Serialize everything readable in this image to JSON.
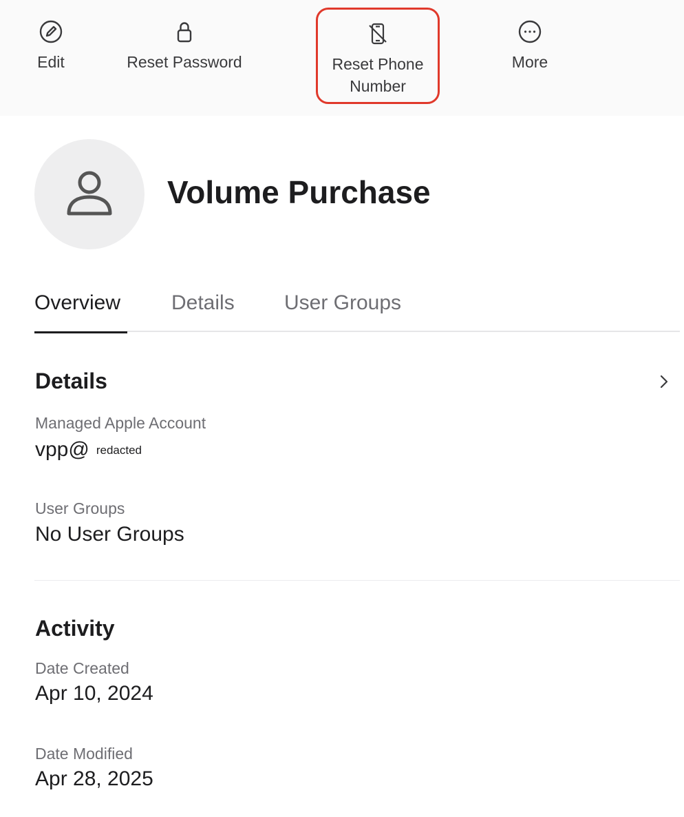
{
  "toolbar": {
    "edit": {
      "label": "Edit",
      "icon": "pencil-circle-icon"
    },
    "reset_password": {
      "label": "Reset Password",
      "icon": "lock-icon"
    },
    "reset_phone": {
      "label": "Reset Phone Number",
      "icon": "phone-slash-icon",
      "highlight_color": "#e0392b"
    },
    "more": {
      "label": "More",
      "icon": "ellipsis-circle-icon"
    }
  },
  "user": {
    "name": "Volume Purchase",
    "avatar_icon": "person-icon"
  },
  "tabs": [
    {
      "label": "Overview",
      "active": true
    },
    {
      "label": "Details",
      "active": false
    },
    {
      "label": "User Groups",
      "active": false
    }
  ],
  "details": {
    "title": "Details",
    "managed_account_label": "Managed Apple Account",
    "managed_account_value": "vpp@",
    "managed_account_redacted": "redacted",
    "user_groups_label": "User Groups",
    "user_groups_value": "No User Groups"
  },
  "activity": {
    "title": "Activity",
    "date_created_label": "Date Created",
    "date_created_value": "Apr 10, 2024",
    "date_modified_label": "Date Modified",
    "date_modified_value": "Apr 28, 2025"
  }
}
